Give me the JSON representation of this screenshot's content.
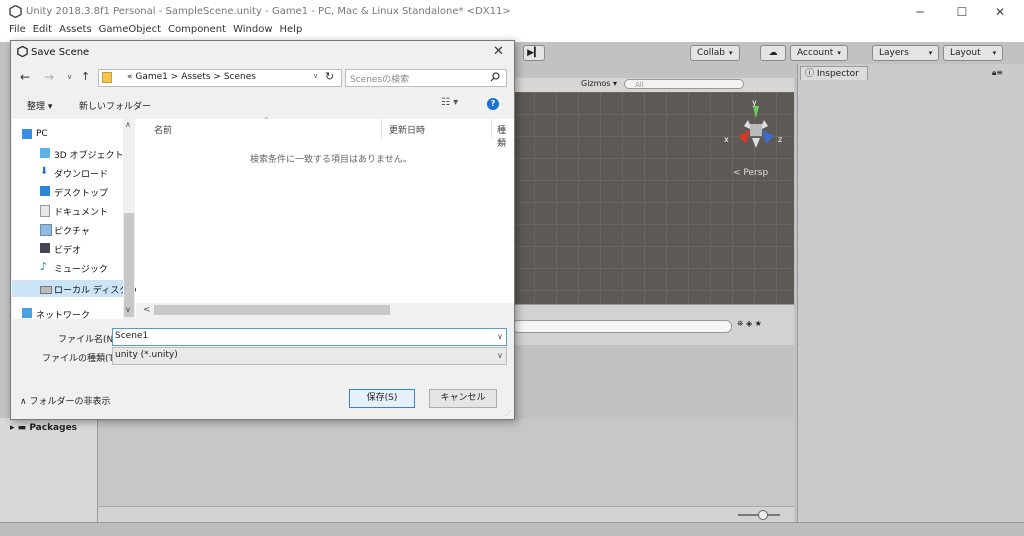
{
  "window": {
    "title": "Unity 2018.3.8f1 Personal - SampleScene.unity - Game1 - PC, Mac & Linux Standalone* <DX11>",
    "min": "─",
    "max": "☐",
    "close": "✕"
  },
  "menu": [
    "File",
    "Edit",
    "Assets",
    "GameObject",
    "Component",
    "Window",
    "Help"
  ],
  "toolbar": {
    "collab": "Collab",
    "cloud": "☁",
    "account": "Account",
    "layers": "Layers",
    "layout": "Layout",
    "caret": "▾",
    "step": "▶▎"
  },
  "scene": {
    "gizmos": "Gizmos",
    "search_placeholder": "All",
    "persp": "Persp",
    "axis_x": "x",
    "axis_y": "y",
    "axis_z": "z"
  },
  "inspector": {
    "tab": "Inspector"
  },
  "project": {
    "packages": "Packages"
  },
  "dialog": {
    "title": "Save Scene",
    "close": "✕",
    "address": {
      "prefix": "«",
      "crumbs": [
        "Game1",
        "Assets",
        "Scenes"
      ],
      "sep": ">"
    },
    "search_placeholder": "Scenesの検索",
    "organize": "整理",
    "new_folder": "新しいフォルダー",
    "nav": [
      "PC",
      "3D オブジェクト",
      "ダウンロード",
      "デスクトップ",
      "ドキュメント",
      "ピクチャ",
      "ビデオ",
      "ミュージック",
      "ローカル ディスク (C",
      "ネットワーク"
    ],
    "columns": {
      "name": "名前",
      "date": "更新日時",
      "type": "種類"
    },
    "empty_message": "検索条件に一致する項目はありません。",
    "filename_label": "ファイル名(N):",
    "filename_value": "Scene1",
    "filetype_label": "ファイルの種類(T):",
    "filetype_value": "unity (*.unity)",
    "hide_folders": "フォルダーの非表示",
    "save": "保存(S)",
    "cancel": "キャンセル"
  }
}
